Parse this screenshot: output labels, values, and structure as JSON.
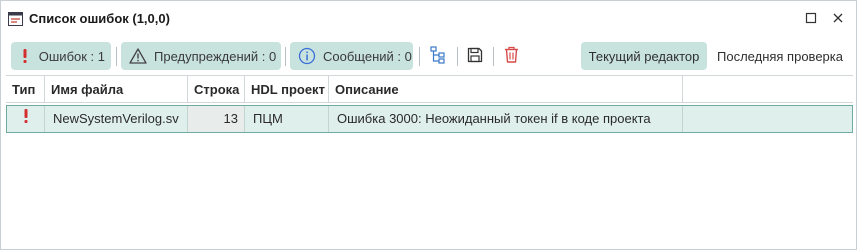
{
  "window": {
    "title": "Список ошибок (1,0,0)",
    "icons": {
      "title": "error-list-window-icon",
      "maximize": "maximize-icon",
      "close": "close-icon"
    }
  },
  "toolbar": {
    "errors_label": "Ошибок : 1",
    "warnings_label": "Предупреждений : 0",
    "messages_label": "Сообщений : 0",
    "current_editor_label": "Текущий редактор",
    "last_check_label": "Последняя проверка",
    "icons": {
      "errors": "exclamation-icon",
      "warnings": "warning-triangle-icon",
      "messages": "info-icon",
      "tree": "tree-hierarchy-icon",
      "save": "save-icon",
      "delete": "trash-icon"
    }
  },
  "table": {
    "columns": [
      "Тип",
      "Имя файла",
      "Строка",
      "HDL проект",
      "Описание"
    ],
    "rows": [
      {
        "type_icon": "error-exclamation-icon",
        "file": "NewSystemVerilog.sv",
        "line": "13",
        "project": "ПЦМ",
        "description": "Ошибка 3000: Неожиданный токен if в коде проекта"
      }
    ]
  },
  "colors": {
    "accent_bg": "#c8e2de",
    "row_selected_bg": "#dff0ec",
    "row_selected_border": "#6fa9a0",
    "error_red": "#d32f2f",
    "info_blue": "#3a6fd8",
    "delete_red": "#d84a4a",
    "tree_blue": "#3a78c9"
  }
}
